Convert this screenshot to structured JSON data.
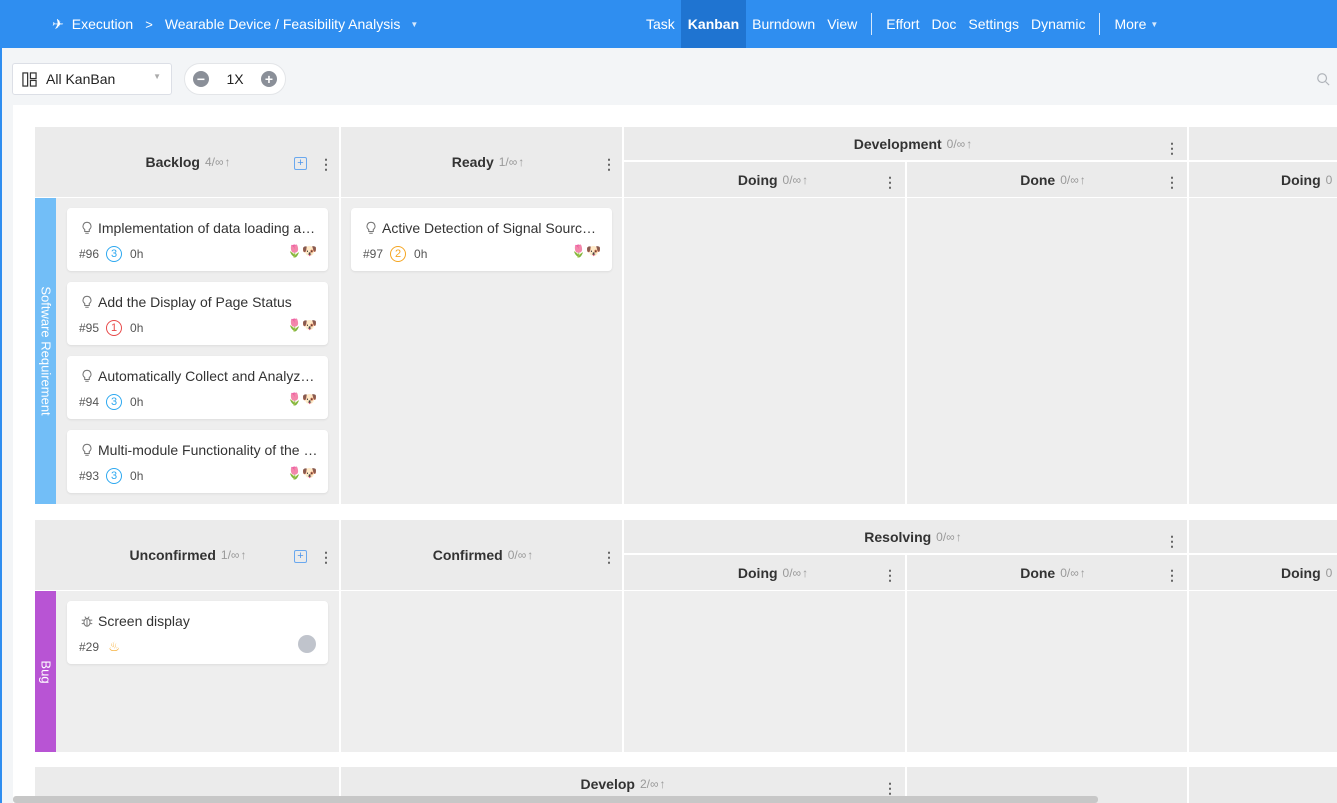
{
  "nav": {
    "breadcrumb_root": "Execution",
    "breadcrumb_sep": ">",
    "project": "Wearable Device / Feasibility Analysis",
    "links": [
      "Task",
      "Kanban",
      "Burndown",
      "View",
      "Effort",
      "Doc",
      "Settings",
      "Dynamic",
      "More"
    ],
    "active": "Kanban"
  },
  "toolbar": {
    "kanban_select": "All KanBan",
    "zoom_level": "1X",
    "zoom_out": "−",
    "zoom_in": "+"
  },
  "icons": {
    "execution": "running-person-icon",
    "kanban": "grid-layout-icon",
    "search": "search-icon",
    "card_story": "lightbulb-icon",
    "card_bug": "bug-icon",
    "more": "vertical-ellipsis-icon",
    "add": "add-card-icon"
  },
  "colors": {
    "nav_bg": "#2f8ef0",
    "nav_active": "#1f74d1",
    "lane_story": "#72bef7",
    "lane_bug": "#b854d4",
    "pri_1": "#e84a4a",
    "pri_2": "#f5a623",
    "pri_3": "#2da8f0"
  },
  "lanes": {
    "story": {
      "label": "Software Requirement",
      "headers": {
        "backlog": {
          "name": "Backlog",
          "count": "4/∞"
        },
        "ready": {
          "name": "Ready",
          "count": "1/∞"
        },
        "development": {
          "name": "Development",
          "count": "0/∞"
        },
        "dev_doing": {
          "name": "Doing",
          "count": "0/∞"
        },
        "dev_done": {
          "name": "Done",
          "count": "0/∞"
        },
        "next_doing": {
          "name": "Doing",
          "count": "0"
        }
      },
      "cards": [
        {
          "title": "Implementation of data loading and storage",
          "id": "#96",
          "pri": "3",
          "hours": "0h"
        },
        {
          "title": "Add the Display of Page Status",
          "id": "#95",
          "pri": "1",
          "hours": "0h"
        },
        {
          "title": "Automatically Collect and Analyze Data",
          "id": "#94",
          "pri": "3",
          "hours": "0h"
        },
        {
          "title": "Multi-module Functionality of the Device",
          "id": "#93",
          "pri": "3",
          "hours": "0h"
        },
        {
          "title": "Active Detection of Signal Source Location",
          "id": "#97",
          "pri": "2",
          "hours": "0h"
        }
      ]
    },
    "bug": {
      "label": "Bug",
      "headers": {
        "unconfirmed": {
          "name": "Unconfirmed",
          "count": "1/∞"
        },
        "confirmed": {
          "name": "Confirmed",
          "count": "0/∞"
        },
        "resolving": {
          "name": "Resolving",
          "count": "0/∞"
        },
        "res_doing": {
          "name": "Doing",
          "count": "0/∞"
        },
        "res_done": {
          "name": "Done",
          "count": "0/∞"
        },
        "next_doing": {
          "name": "Doing",
          "count": "0"
        }
      },
      "cards": [
        {
          "title": "Screen display",
          "id": "#29"
        }
      ]
    },
    "task": {
      "headers": {
        "develop": {
          "name": "Develop",
          "count": "2/∞"
        }
      }
    }
  }
}
